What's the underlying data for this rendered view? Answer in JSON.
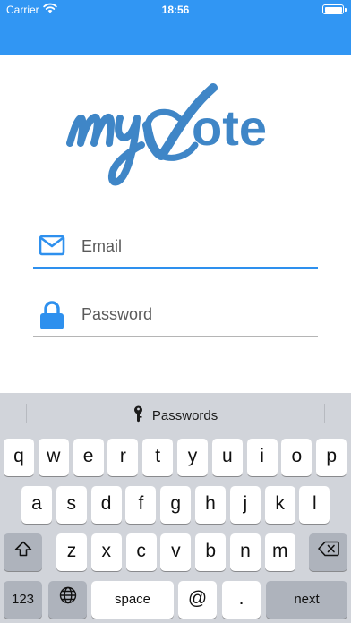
{
  "status_bar": {
    "carrier": "Carrier",
    "time": "18:56"
  },
  "theme": {
    "header_color": "#3196f3",
    "accent": "#2e90ee",
    "logo_color": "#3f86c7",
    "keyboard_bg": "#d1d4da"
  },
  "logo": {
    "text": "myVote"
  },
  "login": {
    "email": {
      "placeholder": "Email",
      "value": "",
      "icon": "envelope-icon"
    },
    "password": {
      "placeholder": "Password",
      "value": "",
      "icon": "lock-icon"
    }
  },
  "keyboard": {
    "suggestion": "Passwords",
    "row1": [
      "q",
      "w",
      "e",
      "r",
      "t",
      "y",
      "u",
      "i",
      "o",
      "p"
    ],
    "row2": [
      "a",
      "s",
      "d",
      "f",
      "g",
      "h",
      "j",
      "k",
      "l"
    ],
    "row3": [
      "z",
      "x",
      "c",
      "v",
      "b",
      "n",
      "m"
    ],
    "numbers_key": "123",
    "space_key": "space",
    "at_key": "@",
    "dot_key": ".",
    "return_key": "next"
  }
}
